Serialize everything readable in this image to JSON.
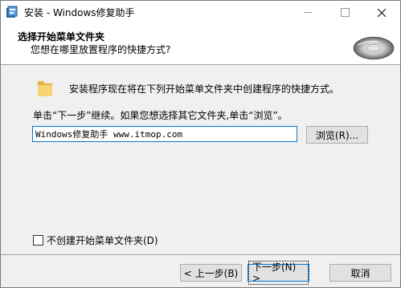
{
  "window": {
    "title": "安装 - Windows修复助手",
    "minimize_icon": "minimize-icon",
    "maximize_icon": "maximize-icon",
    "close_icon": "close-icon"
  },
  "header": {
    "title": "选择开始菜单文件夹",
    "subtitle": "您想在哪里放置程序的快捷方式?",
    "image": "cd-disc-icon"
  },
  "body": {
    "folder_icon": "folder-icon",
    "description": "安装程序现在将在下列开始菜单文件夹中创建程序的快捷方式。",
    "instruction": "单击“下一步”继续。如果您想选择其它文件夹,单击“浏览”。",
    "folder_value": "Windows修复助手 www.itmop.com",
    "browse_label": "浏览(R)...",
    "no_folder_label": "不创建开始菜单文件夹(D)",
    "no_folder_checked": false
  },
  "footer": {
    "back_label": "< 上一步(B)",
    "next_label": "下一步(N) >",
    "cancel_label": "取消"
  },
  "colors": {
    "accent": "#0078d7",
    "window_bg": "#f0f0f0",
    "button_bg": "#e1e1e1"
  }
}
